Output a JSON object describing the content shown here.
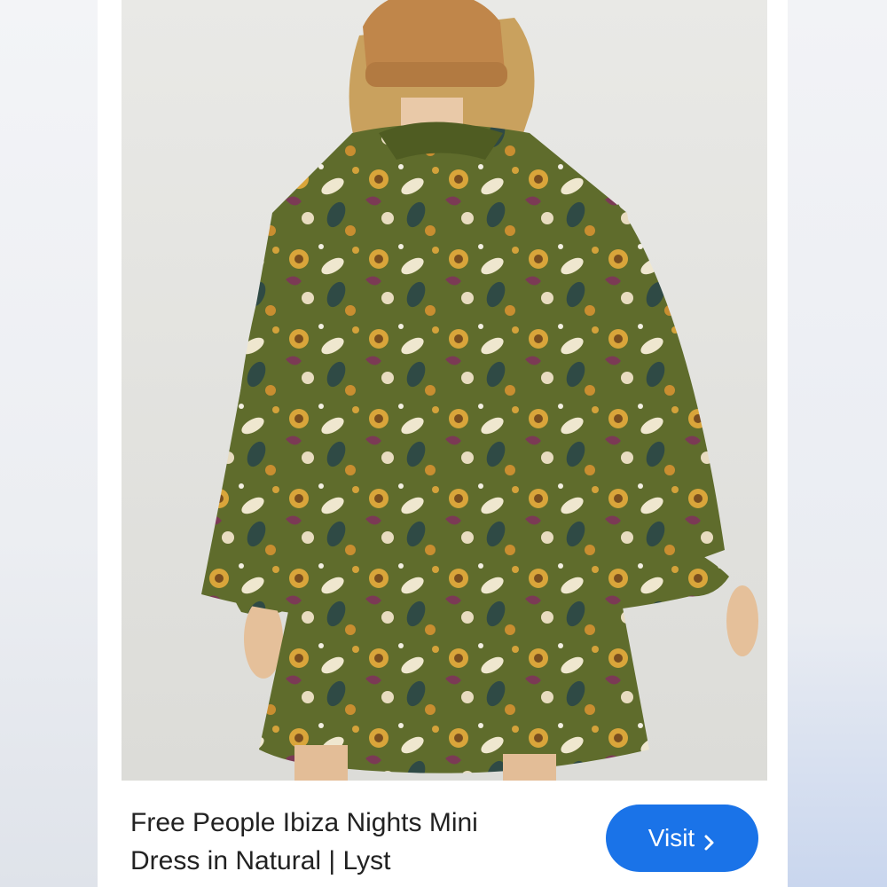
{
  "product": {
    "title_line1": "Free People Ibiza Nights Mini",
    "title_line2": "Dress in Natural | Lyst"
  },
  "visit_button": {
    "label": "Visit",
    "icon": "chevron-right-icon"
  },
  "colors": {
    "button_blue": "#1a73e8",
    "dress_olive": "#5e6b2a",
    "beanie": "#c0864a"
  }
}
